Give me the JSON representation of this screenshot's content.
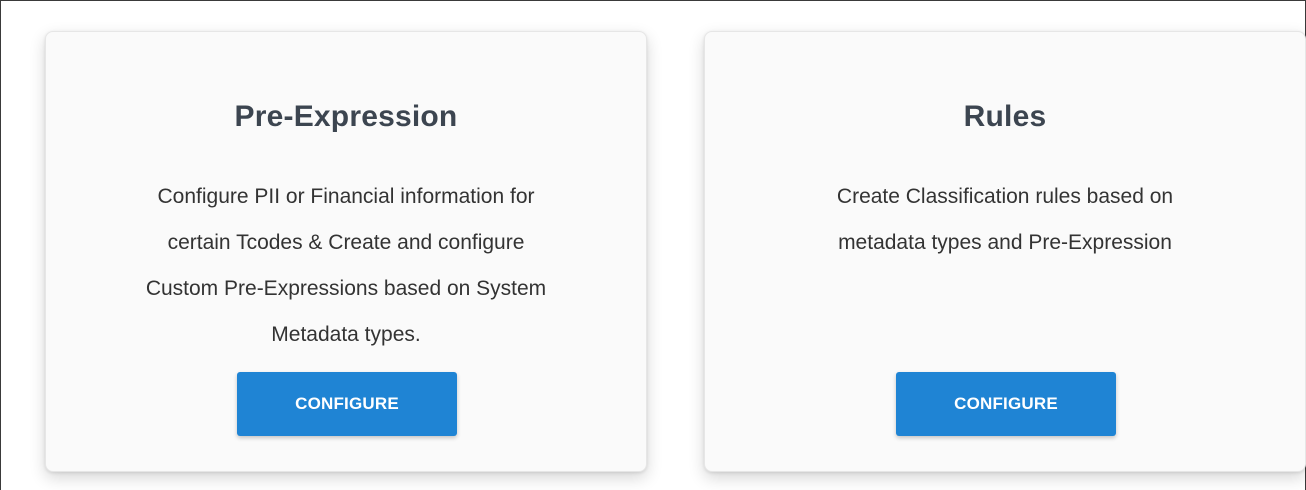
{
  "cards": [
    {
      "title": "Pre-Expression",
      "description": "Configure PII or Financial information for\ncertain Tcodes & Create and configure\nCustom Pre-Expressions based on System\nMetadata types.",
      "button_label": "CONFIGURE"
    },
    {
      "title": "Rules",
      "description": "Create Classification rules based on\nmetadata types and Pre-Expression",
      "button_label": "CONFIGURE"
    }
  ],
  "colors": {
    "button_background": "#1f84d4",
    "button_text": "#ffffff",
    "title_text": "#3c4550",
    "body_text": "#333333",
    "card_background": "#fafafa"
  }
}
